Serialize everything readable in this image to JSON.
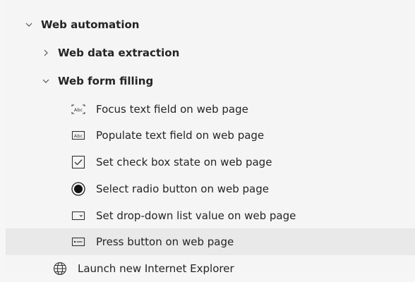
{
  "tree": {
    "group_web_automation": {
      "label": "Web automation"
    },
    "group_web_data_extraction": {
      "label": "Web data extraction"
    },
    "group_web_form_filling": {
      "label": "Web form filling"
    },
    "actions": [
      {
        "label": "Focus text field on web page",
        "icon": "focus-text-field-icon"
      },
      {
        "label": "Populate text field on web page",
        "icon": "populate-text-field-icon"
      },
      {
        "label": "Set check box state on web page",
        "icon": "checkbox-icon"
      },
      {
        "label": "Select radio button on web page",
        "icon": "radio-button-icon"
      },
      {
        "label": "Set drop-down list value on web page",
        "icon": "dropdown-icon"
      },
      {
        "label": "Press button on web page",
        "icon": "button-icon"
      }
    ],
    "launch_ie": {
      "label": "Launch new Internet Explorer",
      "icon": "globe-icon"
    }
  }
}
